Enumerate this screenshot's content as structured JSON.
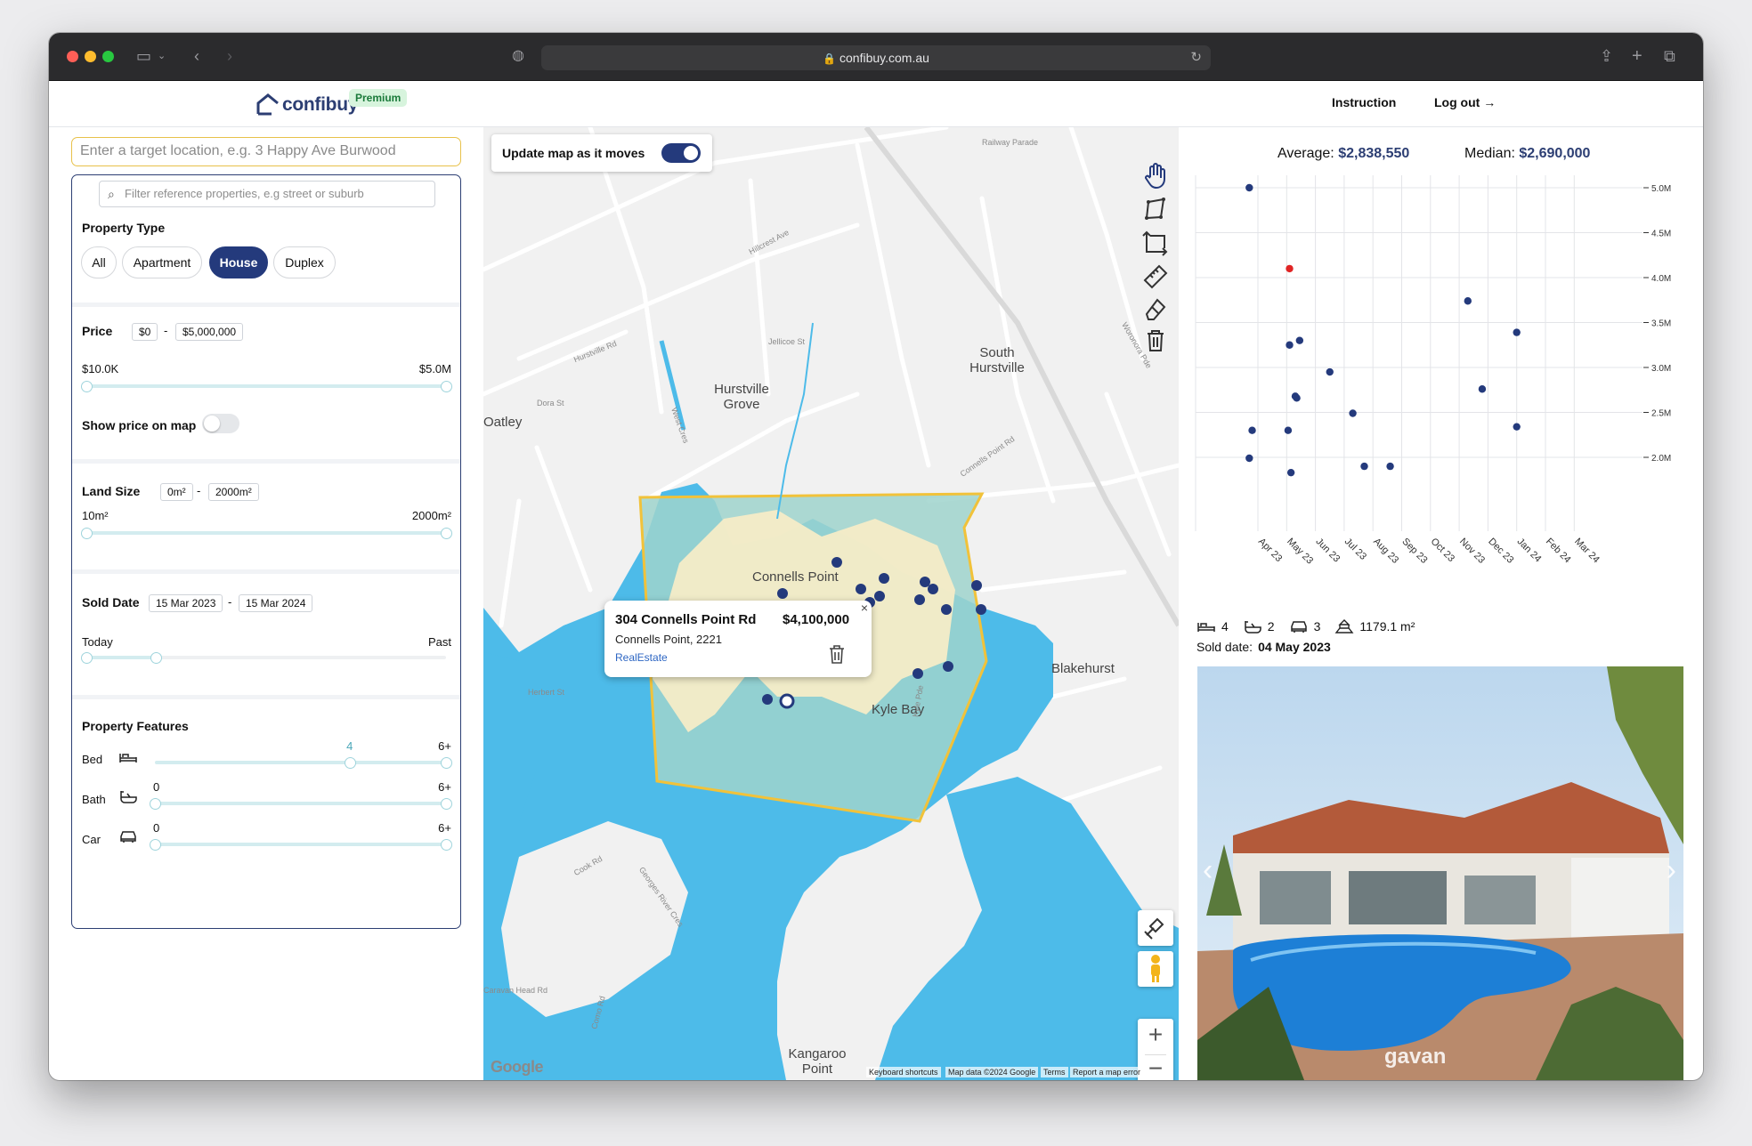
{
  "browser": {
    "url": "confibuy.com.au"
  },
  "app": {
    "brand": "confibuy",
    "badge": "Premium",
    "nav": {
      "instruction": "Instruction",
      "logout": "Log out →"
    }
  },
  "search": {
    "placeholder": "Enter a target location, e.g. 3 Happy Ave Burwood"
  },
  "filters": {
    "filter_placeholder": "Filter reference properties, e.g street or suburb",
    "property_type": {
      "label": "Property Type",
      "options": [
        "All",
        "Apartment",
        "House",
        "Duplex"
      ],
      "selected": "House"
    },
    "price": {
      "label": "Price",
      "min_box": "$0",
      "max_box": "$5,000,000",
      "min_label": "$10.0K",
      "max_label": "$5.0M"
    },
    "show_price": {
      "label": "Show price on map",
      "on": false
    },
    "land": {
      "label": "Land Size",
      "min_box": "0m²",
      "max_box": "2000m²",
      "min_label": "10m²",
      "max_label": "2000m²"
    },
    "sold_date": {
      "label": "Sold Date",
      "from": "15 Mar 2023",
      "to": "15 Mar 2024",
      "left_label": "Today",
      "right_label": "Past"
    },
    "features": {
      "label": "Property Features",
      "bed": {
        "label": "Bed",
        "value": "4",
        "max": "6+",
        "fraction": 0.67
      },
      "bath": {
        "label": "Bath",
        "value": "0",
        "max": "6+",
        "fraction": 0
      },
      "car": {
        "label": "Car",
        "value": "0",
        "max": "6+",
        "fraction": 0
      }
    }
  },
  "map": {
    "update_label": "Update map as it moves",
    "update_on": true,
    "places": [
      "Connells Point",
      "Kyle Bay",
      "Hurstville Grove",
      "South Hurstville",
      "Blakehurst",
      "Oatley",
      "Kangaroo Point"
    ],
    "streets": [
      "Railway Parade",
      "Hillcrest Ave",
      "Hurstville Rd",
      "Connells Point Rd",
      "Kyle Pde",
      "Cook Rd",
      "Georges River Cres",
      "Woronora Pde",
      "Dora St",
      "Jellicoe St",
      "West Cres",
      "Herbert St",
      "Caravan Head Rd",
      "Como Rd"
    ],
    "popup": {
      "address": "304 Connells Point Rd",
      "price": "$4,100,000",
      "suburb": "Connells Point, 2221",
      "source": "RealEstate",
      "close": "×"
    },
    "footer": {
      "shortcuts": "Keyboard shortcuts",
      "data": "Map data ©2024 Google",
      "terms": "Terms",
      "report": "Report a map error"
    },
    "logo": "Google"
  },
  "stats": {
    "average_label": "Average:",
    "average": "$2,838,550",
    "median_label": "Median:",
    "median": "$2,690,000"
  },
  "chart_data": {
    "type": "scatter",
    "x_ticks": [
      "Apr 23",
      "May 23",
      "Jun 23",
      "Jul 23",
      "Aug 23",
      "Sep 23",
      "Oct 23",
      "Nov 23",
      "Dec 23",
      "Jan 24",
      "Feb 24",
      "Mar 24"
    ],
    "y_ticks": [
      "5.0M",
      "4.5M",
      "4.0M",
      "3.5M",
      "3.0M",
      "2.5M",
      "2.0M"
    ],
    "ylim": [
      1.5,
      5.0
    ],
    "grid": true,
    "highlight_color": "#e02424",
    "point_color": "#243a7c",
    "points": [
      {
        "x": -0.3,
        "y": 5.0
      },
      {
        "x": -0.2,
        "y": 2.3
      },
      {
        "x": -0.3,
        "y": 1.99
      },
      {
        "x": 1.1,
        "y": 4.1,
        "highlight": true
      },
      {
        "x": 1.1,
        "y": 3.25
      },
      {
        "x": 1.45,
        "y": 3.3
      },
      {
        "x": 1.3,
        "y": 2.68
      },
      {
        "x": 1.35,
        "y": 2.66
      },
      {
        "x": 1.05,
        "y": 2.3
      },
      {
        "x": 1.15,
        "y": 1.83
      },
      {
        "x": 2.5,
        "y": 2.95
      },
      {
        "x": 3.3,
        "y": 2.49
      },
      {
        "x": 3.7,
        "y": 1.9
      },
      {
        "x": 4.6,
        "y": 1.9
      },
      {
        "x": 7.3,
        "y": 3.74
      },
      {
        "x": 7.8,
        "y": 2.76
      },
      {
        "x": 9.0,
        "y": 3.39
      },
      {
        "x": 9.0,
        "y": 2.34
      }
    ]
  },
  "detail": {
    "beds": "4",
    "baths": "2",
    "cars": "3",
    "land": "1179.1 m²",
    "sold_label": "Sold date:",
    "sold_date": "04 May 2023",
    "watermark": "gavan"
  }
}
